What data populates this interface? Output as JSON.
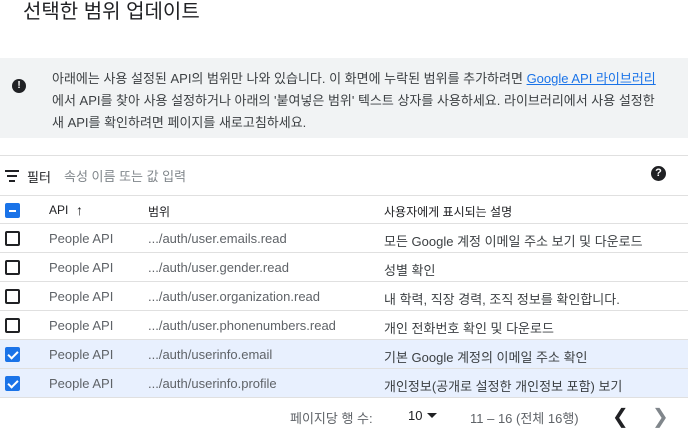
{
  "dialog": {
    "title": "선택한 범위 업데이트"
  },
  "info": {
    "icon": "info-icon",
    "text_before": "아래에는 사용 설정된 API의 범위만 나와 있습니다. 이 화면에 누락된 범위를 추가하려면 ",
    "link_text": "Google API 라이브러리",
    "text_after": "에서 API를 찾아 사용 설정하거나 아래의 '붙여넣은 범위' 텍스트 상자를 사용하세요. 라이브러리에서 사용 설정한 새 API를 확인하려면 페이지를 새로고침하세요."
  },
  "filter": {
    "label": "필터",
    "placeholder": "속성 이름 또는 값 입력",
    "icon": "filter-icon",
    "help_icon": "help-icon"
  },
  "table": {
    "headers": {
      "api": "API",
      "scope": "범위",
      "description": "사용자에게 표시되는 설명"
    },
    "header_checkbox_state": "indeterminate",
    "rows": [
      {
        "checked": false,
        "api": "People API",
        "scope": ".../auth/user.emails.read",
        "description": "모든 Google 계정 이메일 주소 보기 및 다운로드"
      },
      {
        "checked": false,
        "api": "People API",
        "scope": ".../auth/user.gender.read",
        "description": "성별 확인"
      },
      {
        "checked": false,
        "api": "People API",
        "scope": ".../auth/user.organization.read",
        "description": "내 학력, 직장 경력, 조직 정보를 확인합니다."
      },
      {
        "checked": false,
        "api": "People API",
        "scope": ".../auth/user.phonenumbers.read",
        "description": "개인 전화번호 확인 및 다운로드"
      },
      {
        "checked": true,
        "api": "People API",
        "scope": ".../auth/userinfo.email",
        "description": "기본 Google 계정의 이메일 주소 확인"
      },
      {
        "checked": true,
        "api": "People API",
        "scope": ".../auth/userinfo.profile",
        "description": "개인정보(공개로 설정한 개인정보 포함) 보기"
      }
    ]
  },
  "pagination": {
    "rows_per_page_label": "페이지당 행 수:",
    "rows_per_page_value": "10",
    "range_text": "11 – 16 (전체 16행)"
  },
  "colors": {
    "accent": "#1a73e8",
    "selected_row": "#e8f0fe",
    "info_bg": "#f1f3f4"
  }
}
